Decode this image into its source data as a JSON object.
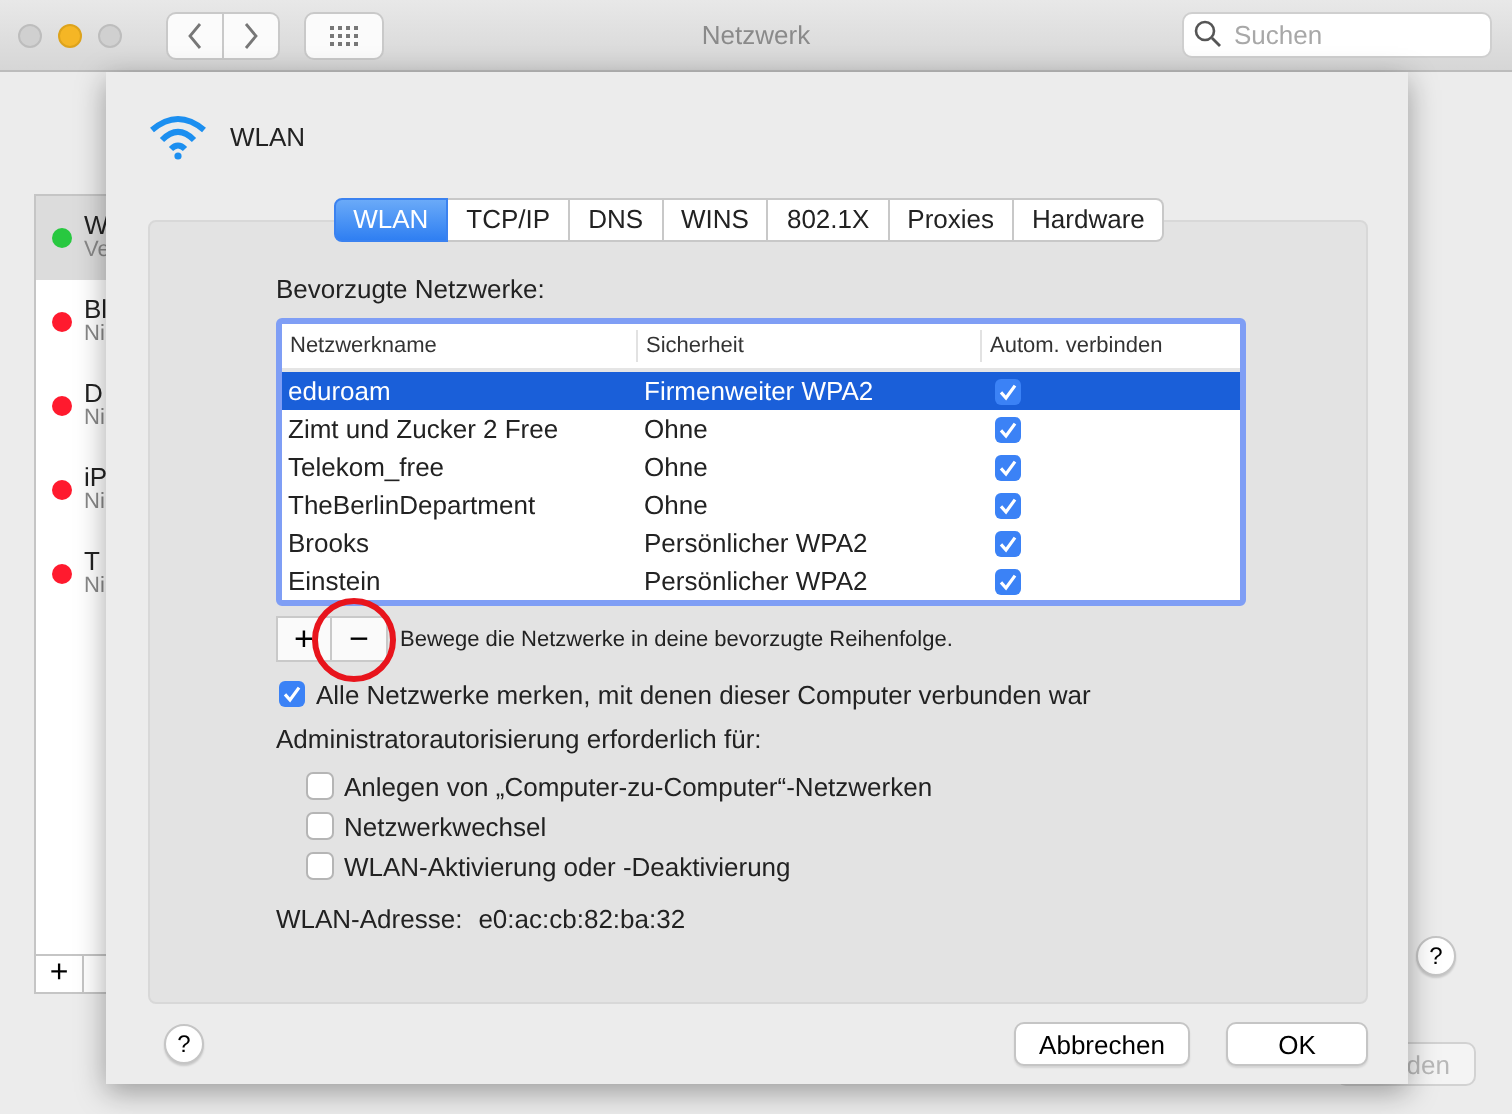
{
  "window": {
    "title": "Netzwerk",
    "search": {
      "placeholder": "Suchen"
    }
  },
  "sidebar": {
    "items": [
      {
        "name": "W",
        "status": "Ve",
        "color": "#28c840",
        "selected": true
      },
      {
        "name": "Bl",
        "status": "Ni",
        "color": "#ff1a2e",
        "selected": false
      },
      {
        "name": "D",
        "status": "Ni",
        "color": "#ff1a2e",
        "selected": false
      },
      {
        "name": "iP",
        "status": "Ni",
        "color": "#ff1a2e",
        "selected": false
      },
      {
        "name": "T",
        "status": "Ni",
        "color": "#ff1a2e",
        "selected": false
      }
    ],
    "buttons": [
      "+"
    ]
  },
  "background": {
    "help": "?",
    "button": "den"
  },
  "sheet": {
    "title": "WLAN",
    "tabs": [
      {
        "label": "WLAN",
        "selected": true
      },
      {
        "label": "TCP/IP",
        "selected": false
      },
      {
        "label": "DNS",
        "selected": false
      },
      {
        "label": "WINS",
        "selected": false
      },
      {
        "label": "802.1X",
        "selected": false
      },
      {
        "label": "Proxies",
        "selected": false
      },
      {
        "label": "Hardware",
        "selected": false
      }
    ],
    "preferred_label": "Bevorzugte Netzwerke:",
    "table": {
      "columns": [
        "Netzwerkname",
        "Sicherheit",
        "Autom. verbinden"
      ],
      "rows": [
        {
          "name": "eduroam",
          "security": "Firmenweiter WPA2",
          "auto_connect": true,
          "selected": true
        },
        {
          "name": "Zimt und Zucker 2 Free",
          "security": "Ohne",
          "auto_connect": true,
          "selected": false
        },
        {
          "name": "Telekom_free",
          "security": "Ohne",
          "auto_connect": true,
          "selected": false
        },
        {
          "name": "TheBerlinDepartment",
          "security": "Ohne",
          "auto_connect": true,
          "selected": false
        },
        {
          "name": "Brooks",
          "security": "Persönlicher WPA2",
          "auto_connect": true,
          "selected": false
        },
        {
          "name": "Einstein",
          "security": "Persönlicher WPA2",
          "auto_connect": true,
          "selected": false
        }
      ]
    },
    "list_buttons": [
      "+",
      "−"
    ],
    "hint": "Bewege die Netzwerke in deine bevorzugte Reihenfolge.",
    "remember": {
      "label": "Alle Netzwerke merken, mit denen dieser Computer verbunden war",
      "checked": true
    },
    "admin_label": "Administratorautorisierung erforderlich für:",
    "admin_options": [
      {
        "label": "Anlegen von „Computer-zu-Computer“-Netzwerken",
        "checked": false
      },
      {
        "label": "Netzwerkwechsel",
        "checked": false
      },
      {
        "label": "WLAN-Aktivierung oder -Deaktivierung",
        "checked": false
      }
    ],
    "address_label": "WLAN-Adresse:",
    "address": "e0:ac:cb:82:ba:32",
    "help": "?",
    "buttons": [
      "Abbrechen",
      "OK"
    ]
  }
}
